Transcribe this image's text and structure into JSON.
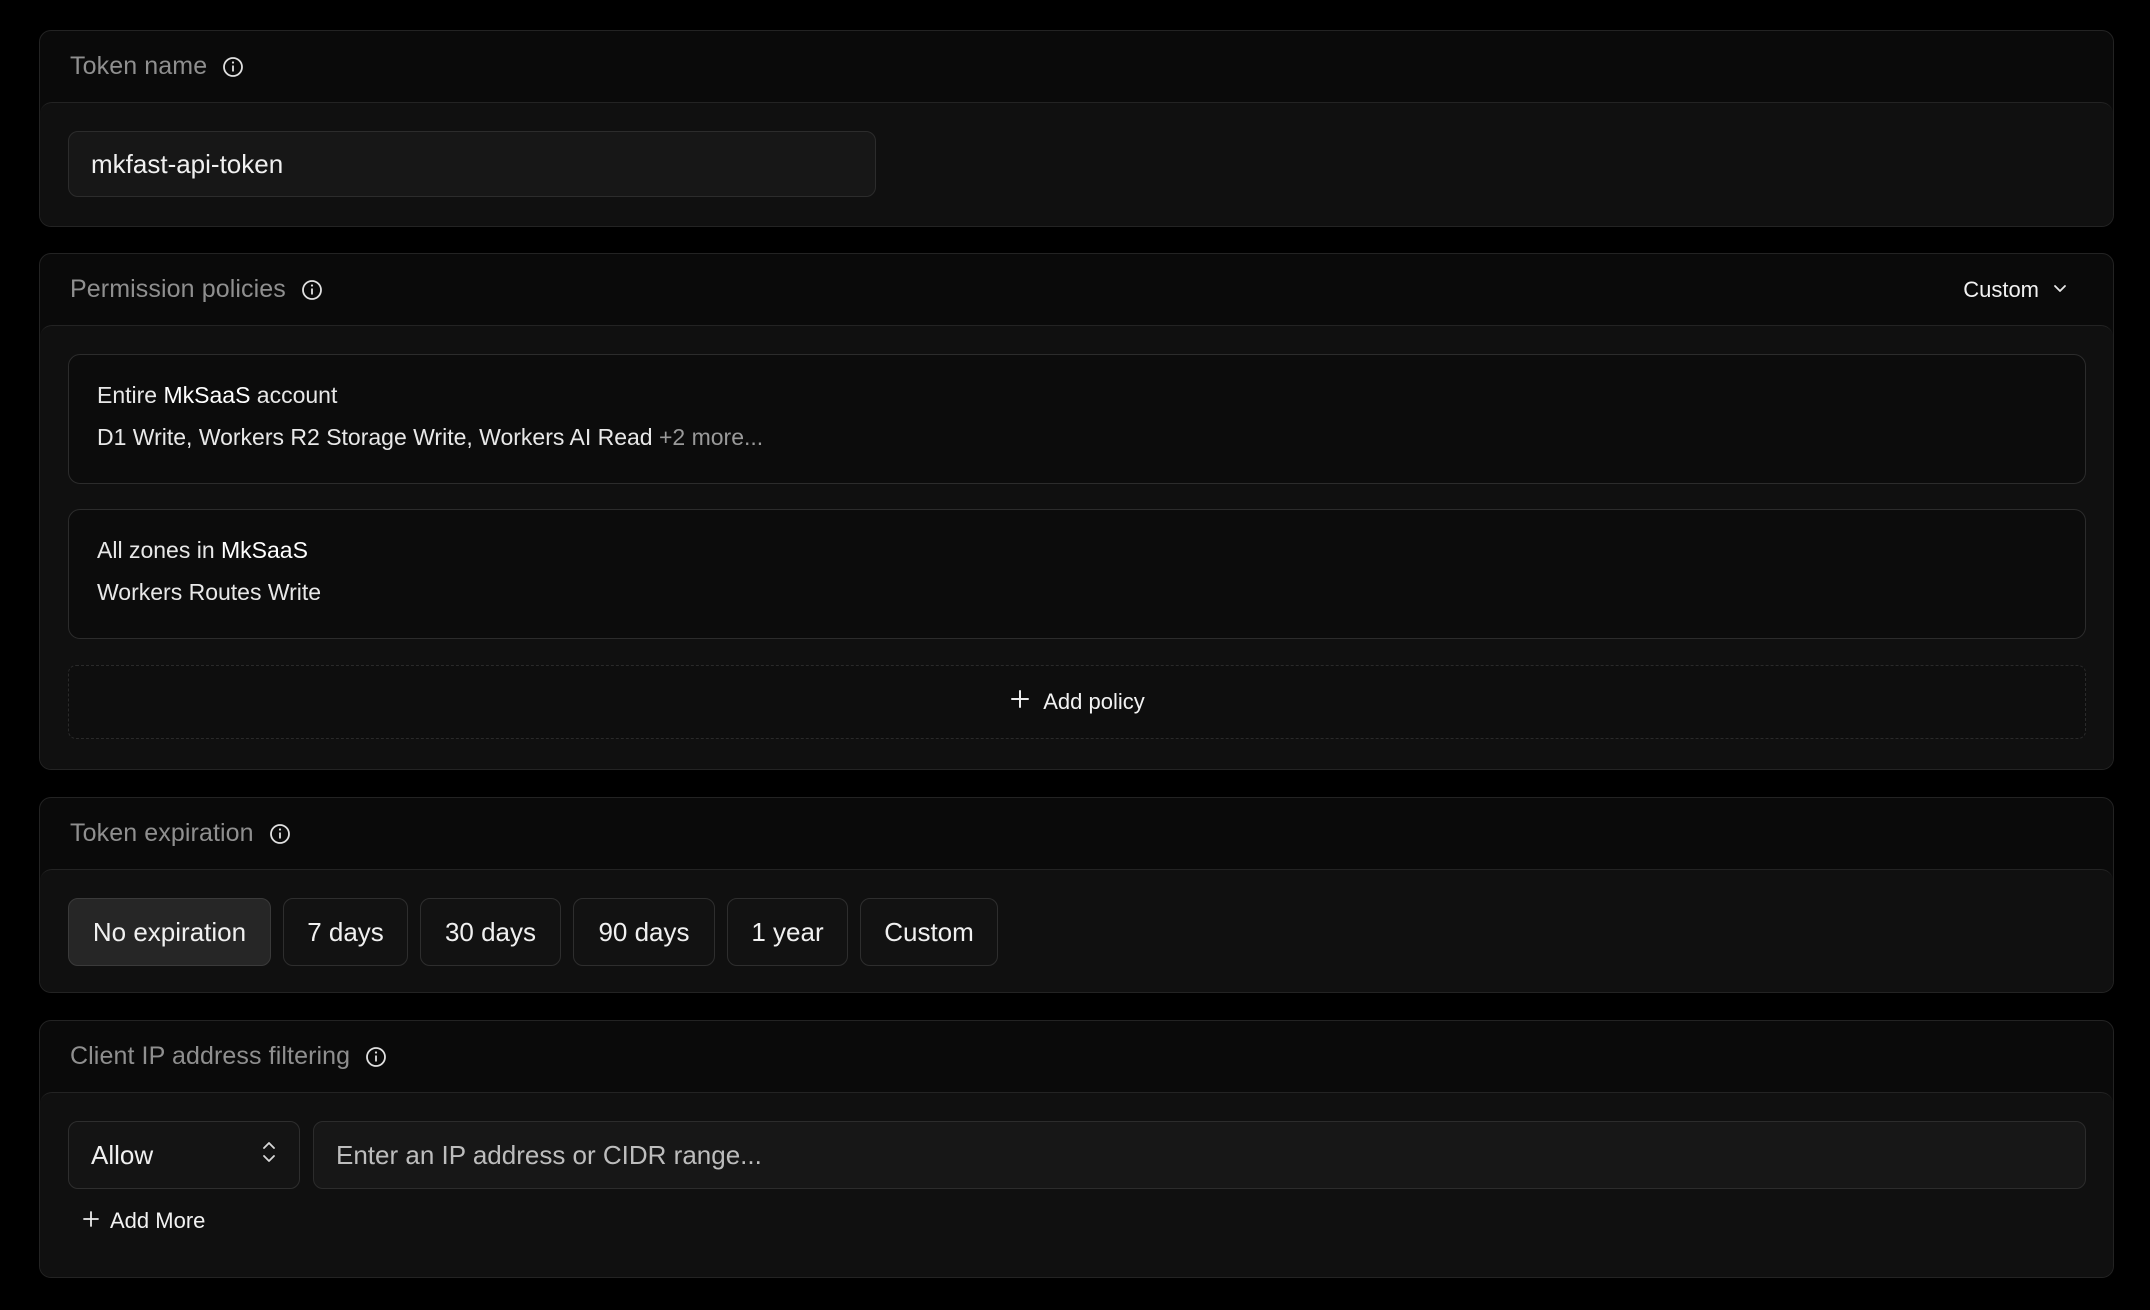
{
  "token_name": {
    "title": "Token name",
    "info_icon": "info-icon",
    "value": "mkfast-api-token"
  },
  "permission_policies": {
    "title": "Permission policies",
    "info_icon": "info-icon",
    "dropdown_label": "Custom",
    "dropdown_icon": "chevron-down-icon",
    "policies": [
      {
        "scope_prefix": "Entire ",
        "scope_name": "MkSaaS",
        "scope_suffix": " account",
        "permissions": "D1 Write, Workers R2 Storage Write, Workers AI Read",
        "more": "+2 more..."
      },
      {
        "scope_prefix": "All zones in ",
        "scope_name": "MkSaaS",
        "scope_suffix": "",
        "permissions": "Workers Routes Write",
        "more": ""
      }
    ],
    "add_policy_label": "Add policy",
    "add_icon": "plus-icon"
  },
  "token_expiration": {
    "title": "Token expiration",
    "info_icon": "info-icon",
    "options": [
      "No expiration",
      "7 days",
      "30 days",
      "90 days",
      "1 year",
      "Custom"
    ],
    "selected": "No expiration"
  },
  "ip_filtering": {
    "title": "Client IP address filtering",
    "info_icon": "info-icon",
    "mode_value": "Allow",
    "mode_icon": "chevron-up-down-icon",
    "ip_placeholder": "Enter an IP address or CIDR range...",
    "add_more_label": "Add More",
    "add_icon": "plus-icon"
  }
}
